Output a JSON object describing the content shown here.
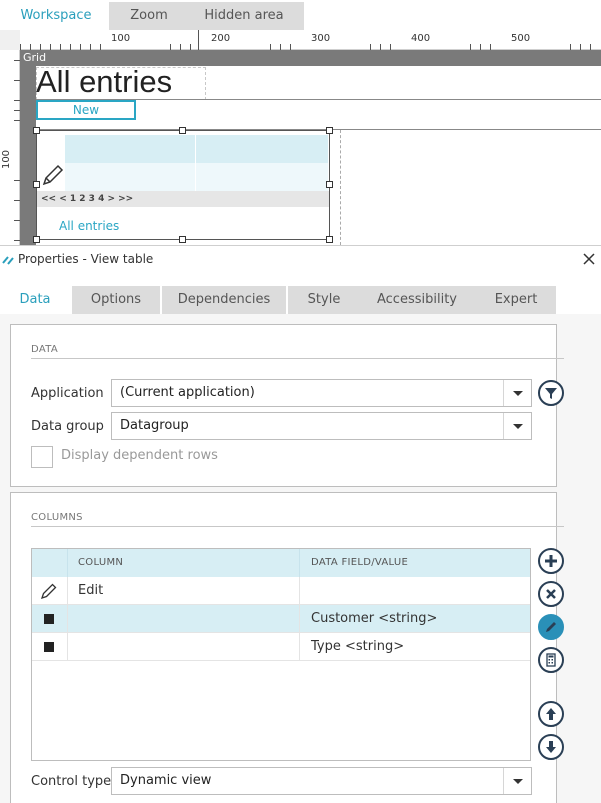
{
  "top_tabs": [
    "Workspace",
    "Zoom",
    "Hidden area"
  ],
  "ruler": {
    "h_labels": [
      "100",
      "200",
      "300",
      "400",
      "500"
    ],
    "v_labels": [
      "100"
    ]
  },
  "designer": {
    "grid_label": "Grid",
    "page_title": "All entries",
    "new_button": "New",
    "pager": "<< < 1 2 3 4 > >>",
    "view_table_link": "All entries"
  },
  "properties": {
    "title": "Properties - View table",
    "tabs": [
      "Data",
      "Options",
      "Dependencies",
      "Style",
      "Accessibility",
      "Expert"
    ],
    "active_tab": "Data",
    "data_section": {
      "heading": "DATA",
      "application_label": "Application",
      "application_value": "(Current application)",
      "datagroup_label": "Data group",
      "datagroup_value": "Datagroup",
      "dependent_rows_label": "Display dependent rows"
    },
    "columns_section": {
      "heading": "COLUMNS",
      "col_header_column": "COLUMN",
      "col_header_field": "DATA FIELD/VALUE",
      "rows": [
        {
          "column": "Edit",
          "field": "",
          "icon": "pencil-icon",
          "selected": false
        },
        {
          "column": "",
          "field": "Customer <string>",
          "icon": "square-icon",
          "selected": true
        },
        {
          "column": "",
          "field": "Type <string>",
          "icon": "square-icon",
          "selected": false
        }
      ],
      "control_type_label": "Control type",
      "control_type_value": "Dynamic view"
    }
  },
  "colors": {
    "accent": "#2a9fbc",
    "selected_row": "#d7eef4",
    "grid_bar": "#7a7a7a"
  }
}
